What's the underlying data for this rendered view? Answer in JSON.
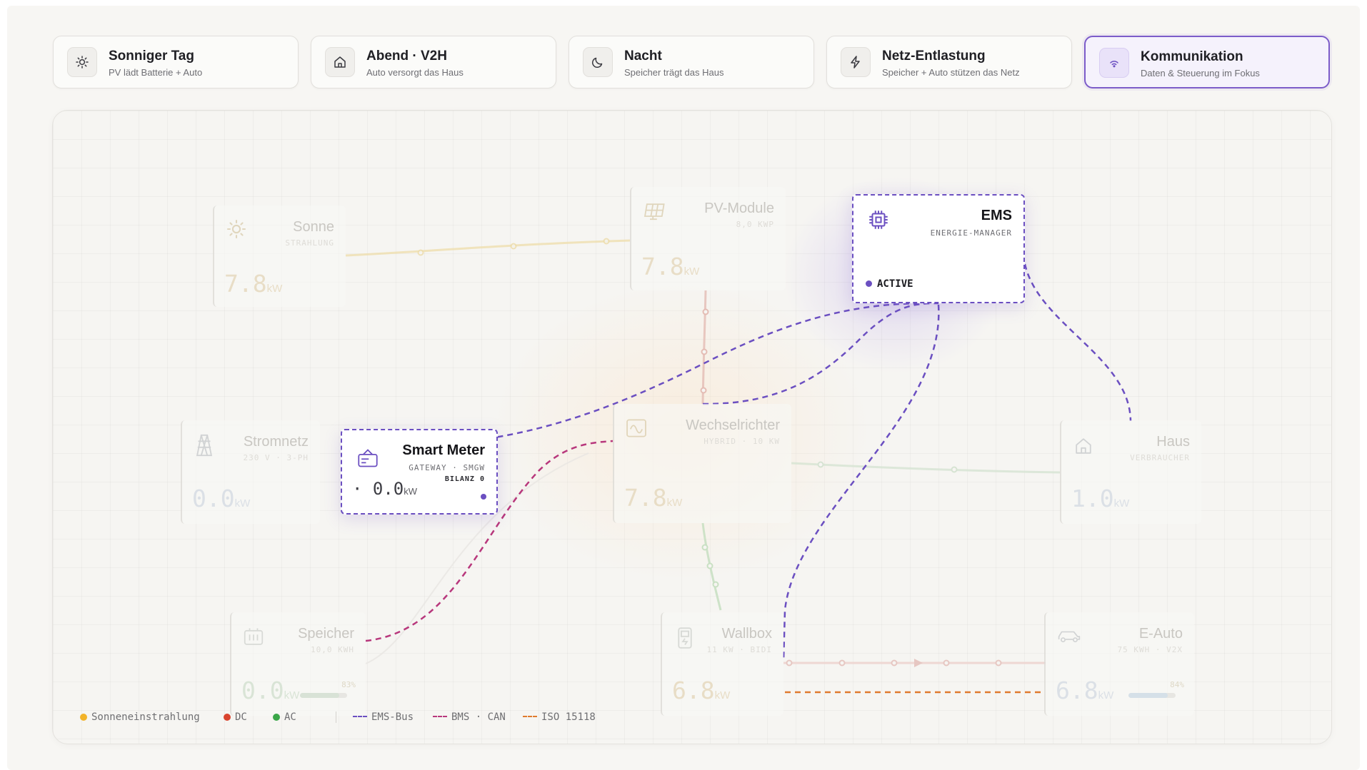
{
  "tabs": [
    {
      "title": "Sonniger Tag",
      "subtitle": "PV lädt Batterie + Auto",
      "icon": "sun-icon"
    },
    {
      "title": "Abend · V2H",
      "subtitle": "Auto versorgt das Haus",
      "icon": "home-icon"
    },
    {
      "title": "Nacht",
      "subtitle": "Speicher trägt das Haus",
      "icon": "moon-icon"
    },
    {
      "title": "Netz-Entlastung",
      "subtitle": "Speicher + Auto stützen das Netz",
      "icon": "lightning-icon"
    },
    {
      "title": "Kommunikation",
      "subtitle": "Daten & Steuerung im Fokus",
      "icon": "wifi-icon",
      "active": true
    }
  ],
  "nodes": {
    "sonne": {
      "name": "Sonne",
      "sub": "STRAHLUNG",
      "value": "7.8",
      "unit": "kW"
    },
    "pv": {
      "name": "PV-Module",
      "sub": "8,0 KWP",
      "value": "7.8",
      "unit": "kW"
    },
    "ems": {
      "name": "EMS",
      "sub": "ENERGIE-MANAGER",
      "status": "ACTIVE"
    },
    "stromnetz": {
      "name": "Stromnetz",
      "sub": "230 V · 3-PH",
      "value": "0.0",
      "unit": "kW"
    },
    "smartmeter": {
      "name": "Smart Meter",
      "sub": "GATEWAY · SMGW",
      "extra": "BILANZ 0",
      "value": "· 0.0",
      "unit": "kW"
    },
    "wechselrichter": {
      "name": "Wechselrichter",
      "sub": "HYBRID · 10 KW",
      "value": "7.8",
      "unit": "kW"
    },
    "haus": {
      "name": "Haus",
      "sub": "VERBRAUCHER",
      "value": "1.0",
      "unit": "kW"
    },
    "speicher": {
      "name": "Speicher",
      "sub": "10,0 KWH",
      "value": "0.0",
      "unit": "kW",
      "soc_label": "83%",
      "soc": 0.83
    },
    "wallbox": {
      "name": "Wallbox",
      "sub": "11 KW · BIDI",
      "value": "6.8",
      "unit": "kW"
    },
    "eauto": {
      "name": "E-Auto",
      "sub": "75 KWH · V2X",
      "value": "6.8",
      "unit": "kW",
      "soc_label": "84%",
      "soc": 0.84
    }
  },
  "legend": {
    "items": [
      {
        "label": "Sonneneinstrahlung",
        "color": "#f2b329"
      },
      {
        "label": "DC",
        "color": "#d9442e"
      },
      {
        "label": "AC",
        "color": "#3aa648"
      }
    ],
    "lines": [
      {
        "label": "EMS-Bus",
        "color": "#6b4fc1"
      },
      {
        "label": "BMS · CAN",
        "color": "#b8377c"
      },
      {
        "label": "ISO 15118",
        "color": "#e07a2e"
      }
    ]
  },
  "colors": {
    "ems_bus": "#6b4fc1",
    "bms_can": "#b8377c",
    "iso15118": "#e07a2e",
    "accent": "#7c5cc9"
  }
}
